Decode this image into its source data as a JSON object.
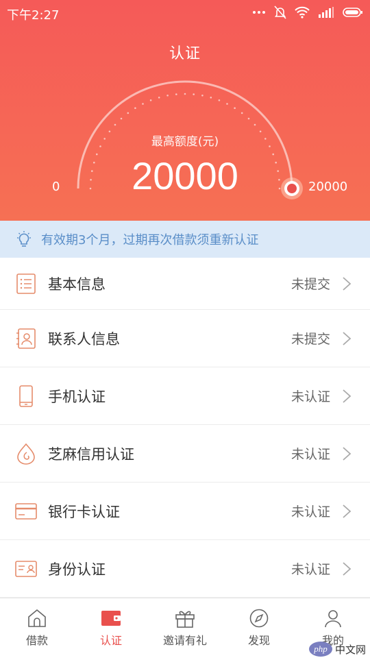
{
  "status_bar": {
    "time": "下午2:27"
  },
  "header": {
    "title": "认证",
    "limit_label": "最高额度(元)",
    "limit_value": "20000",
    "gauge_min": "0",
    "gauge_max": "20000",
    "gauge_level": 1.0
  },
  "notice": {
    "text": "有效期3个月，过期再次借款须重新认证"
  },
  "items": [
    {
      "label": "基本信息",
      "status": "未提交",
      "icon": "list-document-icon"
    },
    {
      "label": "联系人信息",
      "status": "未提交",
      "icon": "contact-card-icon"
    },
    {
      "label": "手机认证",
      "status": "未认证",
      "icon": "mobile-phone-icon"
    },
    {
      "label": "芝麻信用认证",
      "status": "未认证",
      "icon": "sesame-credit-icon"
    },
    {
      "label": "银行卡认证",
      "status": "未认证",
      "icon": "bank-card-icon"
    },
    {
      "label": "身份认证",
      "status": "未认证",
      "icon": "id-card-icon"
    }
  ],
  "tabs": [
    {
      "label": "借款",
      "icon": "home-icon",
      "active": false
    },
    {
      "label": "认证",
      "icon": "wallet-icon",
      "active": true
    },
    {
      "label": "邀请有礼",
      "icon": "gift-icon",
      "active": false
    },
    {
      "label": "发现",
      "icon": "compass-icon",
      "active": false
    },
    {
      "label": "我的",
      "icon": "user-icon",
      "active": false
    }
  ],
  "watermark": {
    "badge": "php",
    "text": "中文网"
  },
  "colors": {
    "header_top": "#f55a58",
    "header_bottom": "#f67054",
    "accent": "#e9504d",
    "icon": "#e58b6a",
    "notice_bg": "#dbe9f8",
    "notice_text": "#5a8ec8"
  }
}
